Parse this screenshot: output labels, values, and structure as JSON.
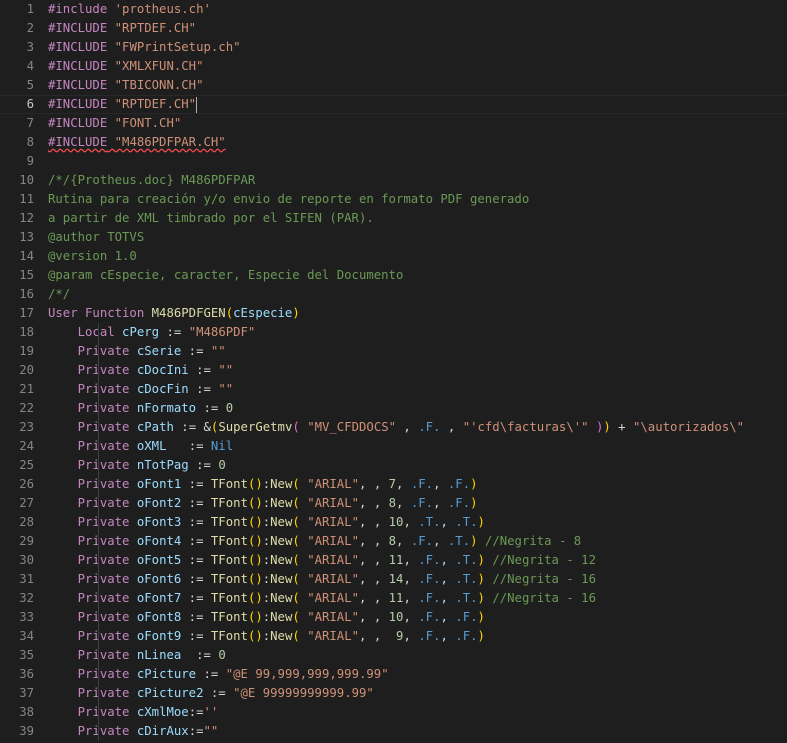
{
  "editor": {
    "current_line": 6,
    "colors": {
      "background": "#1e1e1e",
      "preprocessor": "#c586c0",
      "string": "#ce9178",
      "comment": "#6a9955",
      "keyword": "#569cd6",
      "function": "#dcdcaa",
      "variable": "#9cdcfe",
      "number": "#b5cea8"
    },
    "lines": [
      {
        "n": "1",
        "tokens": [
          [
            "pre",
            "#include "
          ],
          [
            "str",
            "'protheus.ch'"
          ]
        ]
      },
      {
        "n": "2",
        "tokens": [
          [
            "pre",
            "#INCLUDE "
          ],
          [
            "str",
            "\"RPTDEF.CH\""
          ]
        ]
      },
      {
        "n": "3",
        "tokens": [
          [
            "pre",
            "#INCLUDE "
          ],
          [
            "str",
            "\"FWPrintSetup.ch\""
          ]
        ]
      },
      {
        "n": "4",
        "tokens": [
          [
            "pre",
            "#INCLUDE "
          ],
          [
            "str",
            "\"XMLXFUN.CH\""
          ]
        ]
      },
      {
        "n": "5",
        "tokens": [
          [
            "pre",
            "#INCLUDE "
          ],
          [
            "str",
            "\"TBICONN.CH\""
          ]
        ]
      },
      {
        "n": "6",
        "tokens": [
          [
            "pre",
            "#INCLUDE "
          ],
          [
            "str",
            "\"RPTDEF.CH\""
          ],
          [
            "cursor",
            ""
          ]
        ]
      },
      {
        "n": "7",
        "tokens": [
          [
            "pre",
            "#INCLUDE "
          ],
          [
            "str",
            "\"FONT.CH\""
          ]
        ]
      },
      {
        "n": "8",
        "tokens": [
          [
            "pre err",
            "#INCLUDE"
          ],
          [
            "err",
            " "
          ],
          [
            "str err",
            "\"M486PDFPAR.CH\""
          ]
        ]
      },
      {
        "n": "9",
        "tokens": []
      },
      {
        "n": "10",
        "tokens": [
          [
            "cmt",
            "/*/{Protheus.doc} M486PDFPAR"
          ]
        ]
      },
      {
        "n": "11",
        "tokens": [
          [
            "cmt",
            "Rutina para creación y/o envio de reporte en formato PDF generado"
          ]
        ]
      },
      {
        "n": "12",
        "tokens": [
          [
            "cmt",
            "a partir de XML timbrado por el SIFEN (PAR)."
          ]
        ]
      },
      {
        "n": "13",
        "tokens": [
          [
            "cmt",
            "@author TOTVS"
          ]
        ]
      },
      {
        "n": "14",
        "tokens": [
          [
            "cmt",
            "@version 1.0"
          ]
        ]
      },
      {
        "n": "15",
        "tokens": [
          [
            "cmt",
            "@param cEspecie, caracter, Especie del Documento"
          ]
        ]
      },
      {
        "n": "16",
        "tokens": [
          [
            "cmt",
            "/*/"
          ]
        ]
      },
      {
        "n": "17",
        "tokens": [
          [
            "kw2",
            "User Function "
          ],
          [
            "fn",
            "M486PDFGEN"
          ],
          [
            "p1",
            "("
          ],
          [
            "var",
            "cEspecie"
          ],
          [
            "p1",
            ")"
          ]
        ]
      },
      {
        "n": "18",
        "indent": true,
        "tokens": [
          [
            "kw2",
            "Local "
          ],
          [
            "var",
            "cPerg"
          ],
          [
            "op",
            " := "
          ],
          [
            "str",
            "\"M486PDF\""
          ]
        ]
      },
      {
        "n": "19",
        "indent": true,
        "tokens": [
          [
            "kw2",
            "Private "
          ],
          [
            "var",
            "cSerie"
          ],
          [
            "op",
            " := "
          ],
          [
            "str",
            "\"\""
          ]
        ]
      },
      {
        "n": "20",
        "indent": true,
        "tokens": [
          [
            "kw2",
            "Private "
          ],
          [
            "var",
            "cDocIni"
          ],
          [
            "op",
            " := "
          ],
          [
            "str",
            "\"\""
          ]
        ]
      },
      {
        "n": "21",
        "indent": true,
        "tokens": [
          [
            "kw2",
            "Private "
          ],
          [
            "var",
            "cDocFin"
          ],
          [
            "op",
            " := "
          ],
          [
            "str",
            "\"\""
          ]
        ]
      },
      {
        "n": "22",
        "indent": true,
        "tokens": [
          [
            "kw2",
            "Private "
          ],
          [
            "var",
            "nFormato"
          ],
          [
            "op",
            " := "
          ],
          [
            "num",
            "0"
          ]
        ]
      },
      {
        "n": "23",
        "indent": true,
        "tokens": [
          [
            "kw2",
            "Private "
          ],
          [
            "var",
            "cPath"
          ],
          [
            "op",
            " := &"
          ],
          [
            "p1",
            "("
          ],
          [
            "fn",
            "SuperGetmv"
          ],
          [
            "p2",
            "("
          ],
          [
            "op",
            " "
          ],
          [
            "str",
            "\"MV_CFDDOCS\""
          ],
          [
            "op",
            " , "
          ],
          [
            "lit",
            ".F."
          ],
          [
            "op",
            " , "
          ],
          [
            "str",
            "\"'cfd\\facturas\\'\""
          ],
          [
            "op",
            " "
          ],
          [
            "p2",
            ")"
          ],
          [
            "p1",
            ")"
          ],
          [
            "op",
            " + "
          ],
          [
            "str",
            "\"\\autorizados\\\""
          ]
        ]
      },
      {
        "n": "24",
        "indent": true,
        "tokens": [
          [
            "kw2",
            "Private "
          ],
          [
            "var",
            "oXML"
          ],
          [
            "op",
            "   := "
          ],
          [
            "lit",
            "Nil"
          ]
        ]
      },
      {
        "n": "25",
        "indent": true,
        "tokens": [
          [
            "kw2",
            "Private "
          ],
          [
            "var",
            "nTotPag"
          ],
          [
            "op",
            " := "
          ],
          [
            "num",
            "0"
          ]
        ]
      },
      {
        "n": "26",
        "indent": true,
        "tokens": [
          [
            "kw2",
            "Private "
          ],
          [
            "var",
            "oFont1"
          ],
          [
            "op",
            " := "
          ],
          [
            "fn",
            "TFont"
          ],
          [
            "p1",
            "()"
          ],
          [
            "op",
            ":"
          ],
          [
            "fn",
            "New"
          ],
          [
            "p1",
            "("
          ],
          [
            "op",
            " "
          ],
          [
            "str",
            "\"ARIAL\""
          ],
          [
            "op",
            ", , "
          ],
          [
            "num",
            "7"
          ],
          [
            "op",
            ", "
          ],
          [
            "lit",
            ".F."
          ],
          [
            "op",
            ", "
          ],
          [
            "lit",
            ".F."
          ],
          [
            "p1",
            ")"
          ]
        ]
      },
      {
        "n": "27",
        "indent": true,
        "tokens": [
          [
            "kw2",
            "Private "
          ],
          [
            "var",
            "oFont2"
          ],
          [
            "op",
            " := "
          ],
          [
            "fn",
            "TFont"
          ],
          [
            "p1",
            "()"
          ],
          [
            "op",
            ":"
          ],
          [
            "fn",
            "New"
          ],
          [
            "p1",
            "("
          ],
          [
            "op",
            " "
          ],
          [
            "str",
            "\"ARIAL\""
          ],
          [
            "op",
            ", , "
          ],
          [
            "num",
            "8"
          ],
          [
            "op",
            ", "
          ],
          [
            "lit",
            ".F."
          ],
          [
            "op",
            ", "
          ],
          [
            "lit",
            ".F."
          ],
          [
            "p1",
            ")"
          ]
        ]
      },
      {
        "n": "28",
        "indent": true,
        "tokens": [
          [
            "kw2",
            "Private "
          ],
          [
            "var",
            "oFont3"
          ],
          [
            "op",
            " := "
          ],
          [
            "fn",
            "TFont"
          ],
          [
            "p1",
            "()"
          ],
          [
            "op",
            ":"
          ],
          [
            "fn",
            "New"
          ],
          [
            "p1",
            "("
          ],
          [
            "op",
            " "
          ],
          [
            "str",
            "\"ARIAL\""
          ],
          [
            "op",
            ", , "
          ],
          [
            "num",
            "10"
          ],
          [
            "op",
            ", "
          ],
          [
            "lit",
            ".T."
          ],
          [
            "op",
            ", "
          ],
          [
            "lit",
            ".T."
          ],
          [
            "p1",
            ")"
          ]
        ]
      },
      {
        "n": "29",
        "indent": true,
        "tokens": [
          [
            "kw2",
            "Private "
          ],
          [
            "var",
            "oFont4"
          ],
          [
            "op",
            " := "
          ],
          [
            "fn",
            "TFont"
          ],
          [
            "p1",
            "()"
          ],
          [
            "op",
            ":"
          ],
          [
            "fn",
            "New"
          ],
          [
            "p1",
            "("
          ],
          [
            "op",
            " "
          ],
          [
            "str",
            "\"ARIAL\""
          ],
          [
            "op",
            ", , "
          ],
          [
            "num",
            "8"
          ],
          [
            "op",
            ", "
          ],
          [
            "lit",
            ".F."
          ],
          [
            "op",
            ", "
          ],
          [
            "lit",
            ".T."
          ],
          [
            "p1",
            ")"
          ],
          [
            "op",
            " "
          ],
          [
            "cmt",
            "//Negrita - 8"
          ]
        ]
      },
      {
        "n": "30",
        "indent": true,
        "tokens": [
          [
            "kw2",
            "Private "
          ],
          [
            "var",
            "oFont5"
          ],
          [
            "op",
            " := "
          ],
          [
            "fn",
            "TFont"
          ],
          [
            "p1",
            "()"
          ],
          [
            "op",
            ":"
          ],
          [
            "fn",
            "New"
          ],
          [
            "p1",
            "("
          ],
          [
            "op",
            " "
          ],
          [
            "str",
            "\"ARIAL\""
          ],
          [
            "op",
            ", , "
          ],
          [
            "num",
            "11"
          ],
          [
            "op",
            ", "
          ],
          [
            "lit",
            ".F."
          ],
          [
            "op",
            ", "
          ],
          [
            "lit",
            ".T."
          ],
          [
            "p1",
            ")"
          ],
          [
            "op",
            " "
          ],
          [
            "cmt",
            "//Negrita - 12"
          ]
        ]
      },
      {
        "n": "31",
        "indent": true,
        "tokens": [
          [
            "kw2",
            "Private "
          ],
          [
            "var",
            "oFont6"
          ],
          [
            "op",
            " := "
          ],
          [
            "fn",
            "TFont"
          ],
          [
            "p1",
            "()"
          ],
          [
            "op",
            ":"
          ],
          [
            "fn",
            "New"
          ],
          [
            "p1",
            "("
          ],
          [
            "op",
            " "
          ],
          [
            "str",
            "\"ARIAL\""
          ],
          [
            "op",
            ", , "
          ],
          [
            "num",
            "14"
          ],
          [
            "op",
            ", "
          ],
          [
            "lit",
            ".F."
          ],
          [
            "op",
            ", "
          ],
          [
            "lit",
            ".T."
          ],
          [
            "p1",
            ")"
          ],
          [
            "op",
            " "
          ],
          [
            "cmt",
            "//Negrita - 16"
          ]
        ]
      },
      {
        "n": "32",
        "indent": true,
        "tokens": [
          [
            "kw2",
            "Private "
          ],
          [
            "var",
            "oFont7"
          ],
          [
            "op",
            " := "
          ],
          [
            "fn",
            "TFont"
          ],
          [
            "p1",
            "()"
          ],
          [
            "op",
            ":"
          ],
          [
            "fn",
            "New"
          ],
          [
            "p1",
            "("
          ],
          [
            "op",
            " "
          ],
          [
            "str",
            "\"ARIAL\""
          ],
          [
            "op",
            ", , "
          ],
          [
            "num",
            "11"
          ],
          [
            "op",
            ", "
          ],
          [
            "lit",
            ".F."
          ],
          [
            "op",
            ", "
          ],
          [
            "lit",
            ".T."
          ],
          [
            "p1",
            ")"
          ],
          [
            "op",
            " "
          ],
          [
            "cmt",
            "//Negrita - 16"
          ]
        ]
      },
      {
        "n": "33",
        "indent": true,
        "tokens": [
          [
            "kw2",
            "Private "
          ],
          [
            "var",
            "oFont8"
          ],
          [
            "op",
            " := "
          ],
          [
            "fn",
            "TFont"
          ],
          [
            "p1",
            "()"
          ],
          [
            "op",
            ":"
          ],
          [
            "fn",
            "New"
          ],
          [
            "p1",
            "("
          ],
          [
            "op",
            " "
          ],
          [
            "str",
            "\"ARIAL\""
          ],
          [
            "op",
            ", , "
          ],
          [
            "num",
            "10"
          ],
          [
            "op",
            ", "
          ],
          [
            "lit",
            ".F."
          ],
          [
            "op",
            ", "
          ],
          [
            "lit",
            ".F."
          ],
          [
            "p1",
            ")"
          ]
        ]
      },
      {
        "n": "34",
        "indent": true,
        "tokens": [
          [
            "kw2",
            "Private "
          ],
          [
            "var",
            "oFont9"
          ],
          [
            "op",
            " := "
          ],
          [
            "fn",
            "TFont"
          ],
          [
            "p1",
            "()"
          ],
          [
            "op",
            ":"
          ],
          [
            "fn",
            "New"
          ],
          [
            "p1",
            "("
          ],
          [
            "op",
            " "
          ],
          [
            "str",
            "\"ARIAL\""
          ],
          [
            "op",
            ", ,  "
          ],
          [
            "num",
            "9"
          ],
          [
            "op",
            ", "
          ],
          [
            "lit",
            ".F."
          ],
          [
            "op",
            ", "
          ],
          [
            "lit",
            ".F."
          ],
          [
            "p1",
            ")"
          ]
        ]
      },
      {
        "n": "35",
        "indent": true,
        "tokens": [
          [
            "kw2",
            "Private "
          ],
          [
            "var",
            "nLinea"
          ],
          [
            "op",
            "  := "
          ],
          [
            "num",
            "0"
          ]
        ]
      },
      {
        "n": "36",
        "indent": true,
        "tokens": [
          [
            "kw2",
            "Private "
          ],
          [
            "var",
            "cPicture"
          ],
          [
            "op",
            " := "
          ],
          [
            "str",
            "\"@E 99,999,999,999.99\""
          ]
        ]
      },
      {
        "n": "37",
        "indent": true,
        "tokens": [
          [
            "kw2",
            "Private "
          ],
          [
            "var",
            "cPicture2"
          ],
          [
            "op",
            " := "
          ],
          [
            "str",
            "\"@E 99999999999.99\""
          ]
        ]
      },
      {
        "n": "38",
        "indent": true,
        "tokens": [
          [
            "kw2",
            "Private "
          ],
          [
            "var",
            "cXmlMoe"
          ],
          [
            "op",
            ":="
          ],
          [
            "str",
            "''"
          ]
        ]
      },
      {
        "n": "39",
        "indent": true,
        "tokens": [
          [
            "kw2",
            "Private "
          ],
          [
            "var",
            "cDirAux"
          ],
          [
            "op",
            ":="
          ],
          [
            "str",
            "\"\""
          ]
        ]
      }
    ]
  }
}
